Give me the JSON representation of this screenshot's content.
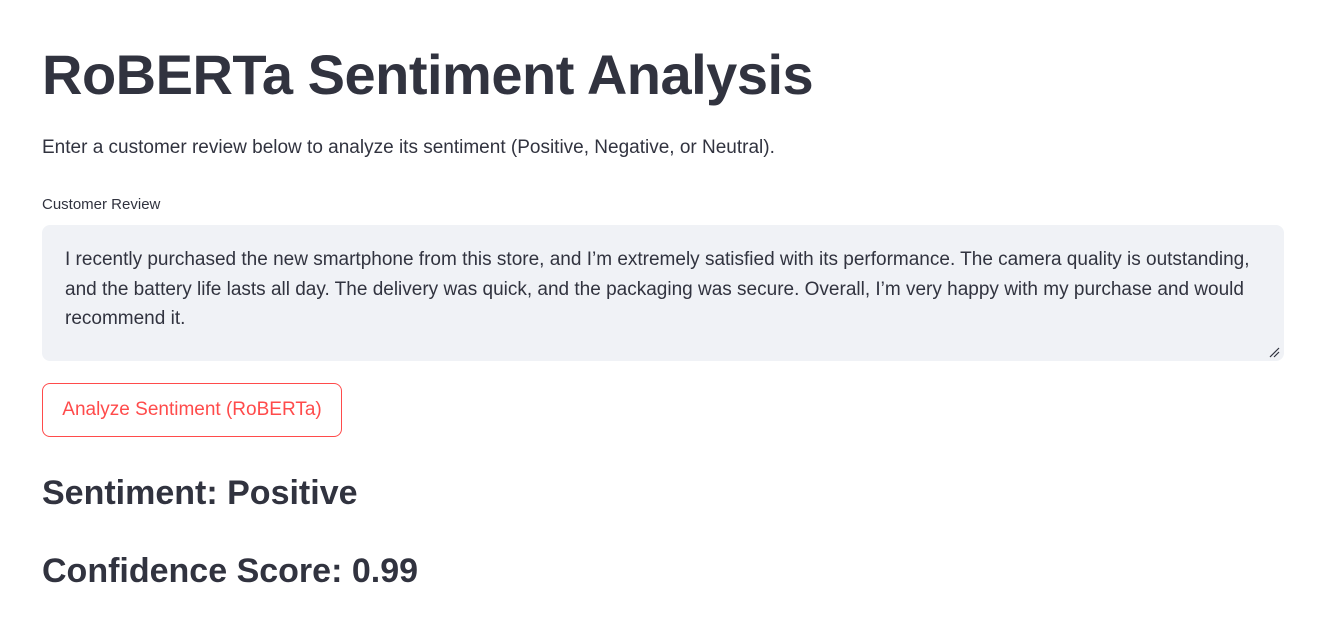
{
  "page": {
    "title": "RoBERTa Sentiment Analysis",
    "intro": "Enter a customer review below to analyze its sentiment (Positive, Negative, or Neutral)."
  },
  "review_field": {
    "label": "Customer Review",
    "value": "I recently purchased the new smartphone from this store, and I’m extremely satisfied with its performance. The camera quality is outstanding, and the battery life lasts all day. The delivery was quick, and the packaging was secure. Overall, I’m very happy with my purchase and would recommend it."
  },
  "analyze_button": {
    "label": "Analyze Sentiment (RoBERTa)"
  },
  "results": {
    "sentiment": "Sentiment: Positive",
    "confidence": "Confidence Score: 0.99"
  },
  "colors": {
    "text": "#31333f",
    "accent": "#ff4b4b",
    "input_background": "#f0f2f6"
  },
  "icons": {
    "resize_handle": "resize-handle-icon"
  }
}
